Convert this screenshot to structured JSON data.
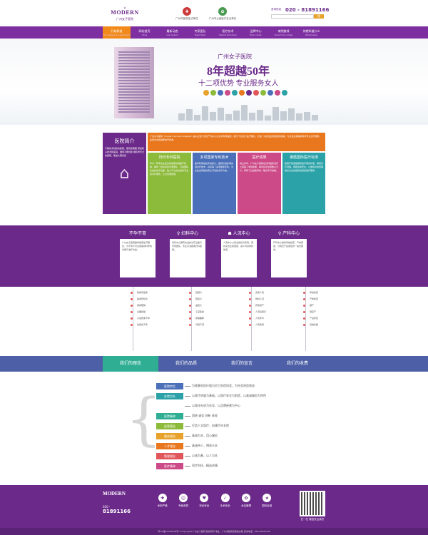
{
  "header": {
    "logo_mark": "MODERN",
    "logo_sub": "广州女子医院",
    "cert1_label": "广州市医保定点单位",
    "cert2_label": "广州市公费医疗定点单位",
    "hotline_label": "咨询热线",
    "hotline_number": "020 - 81891166",
    "search_placeholder": "",
    "search_button": "搜"
  },
  "nav": [
    {
      "cn": "开始释放",
      "en": "The meeting of a department",
      "active": true
    },
    {
      "cn": "网站首页",
      "en": "Home",
      "active": false
    },
    {
      "cn": "最新动态",
      "en": "new dynamic",
      "active": false
    },
    {
      "cn": "专家团队",
      "en": "Expert team",
      "active": false
    },
    {
      "cn": "医疗技术",
      "en": "Medical Technology",
      "active": false
    },
    {
      "cn": "品牌中心",
      "en": "Brand center",
      "active": false
    },
    {
      "cn": "来院路线",
      "en": "Route to the college",
      "active": false
    },
    {
      "cn": "你想知道什么",
      "en": "What besides",
      "active": false
    }
  ],
  "banner": {
    "title": "广州女子医院",
    "big": "8年超越50年",
    "sub": "十二项优势  专业服务女人",
    "icon_colors": [
      "#e8a22b",
      "#8cba3a",
      "#4b6fb8",
      "#cc4a87",
      "#2ba2a8",
      "#e9771e",
      "#6b2a8a",
      "#e0565a",
      "#8cba3a",
      "#4b6fb8",
      "#cc4a87",
      "#2ba2a8"
    ]
  },
  "intro": {
    "main_title": "医院简介",
    "main_text": "不断技术创新的医院，能到您需要 研发核心技术和医院，做到不断创新 拥有学术力的医院，能最大服务您",
    "orange_text": "广州女子医院（modern women hospital）是以女性门诊妇产为中心为主体专科医院，依托“专业化”医疗理念，打造广州女性生殖健康的权威，为女性患者提供科学专业诊疗服务，是南方女性健康的守护者。",
    "green_title": "妇科专科医院",
    "green_text": "作为一家专注女性生殖健康领域医疗机构，拥有一批资深的专家团队，引进国际先进的诊疗设备，致力于为女性提供专业的诊疗服务，让女性更健康。",
    "blue_title": "多项国家专利技术",
    "blue_text": "医学科研是技术的核心，医院引进多项先进诊疗技术，并获得了多项国家专利，为女性患者提供安全可靠的诊疗方案。",
    "pink_title": "医疗成果",
    "pink_text": "成立多年，广州女子医院在妇科临床治疗上取得了丰硕成果，每年接诊患者数以万计，获得了社会各界的一致好评与信赖。",
    "teal_title": "遵循国际医疗标准",
    "teal_text": "医院严格遵循国际医疗服务标准，规范诊疗流程，保障患者安全，以国际化的管理模式为女性提供优质的医疗服务。"
  },
  "centers": [
    {
      "title": "不孕不育",
      "text": "广州女子医院秉承健康生育理念，为不孕不育患者提供科学的诊断与治疗方案。"
    },
    {
      "title": "妇科中心",
      "text": "妇科中心拥有先进的诊疗设备与专家团队，专业诊治各类妇科疾病。"
    },
    {
      "title": "人流中心",
      "text": "人流中心以安全微创为原则，保护女性生殖健康，减少对身体的伤害。"
    },
    {
      "title": "产科中心",
      "text": "产科中心提供孕前检查、产前保健、分娩及产后康复的一站式服务。"
    }
  ],
  "timeline": [
    [
      "输卵管阻塞",
      "输卵管积水",
      "排卵障碍",
      "多囊卵巢",
      "子宫因素不孕",
      "免疫性不孕"
    ],
    [
      "宫颈炎",
      "阴道炎",
      "盆腔炎",
      "子宫肌瘤",
      "卵巢囊肿",
      "月经不调"
    ],
    [
      "无痛人流",
      "微创人流",
      "药物流产",
      "人流后保养",
      "人流手术",
      "人流费用"
    ],
    [
      "孕前检查",
      "产前检查",
      "顺产",
      "剖宫产",
      "产后修复",
      "四维彩超"
    ]
  ],
  "tabs": [
    "我们的理念",
    "我们的品质",
    "我们的宣言",
    "我们的收费"
  ],
  "values": [
    {
      "chip": "医院宗旨",
      "text": "为顾客创造价值为员工创造机会，为社会创造效益",
      "color": "#4b6fb8"
    },
    {
      "chip": "办院方针",
      "text": "以医疗质量为基础，以医疗安全为前提，以真诚服务为特色",
      "color": "#2ba2a8"
    },
    {
      "chip": "",
      "text": "以医技先进为先导，以品牌经营为中心",
      "color": "#ffffff"
    },
    {
      "chip": "医院精神",
      "text": "团结 诚信 创新 高效",
      "color": "#2fae93"
    },
    {
      "chip": "经营理念",
      "text": "打造人文医疗，创建百年名院",
      "color": "#8cba3a"
    },
    {
      "chip": "服务理念",
      "text": "真诚为本，用心服务",
      "color": "#e8a22b"
    },
    {
      "chip": "人才理念",
      "text": "真诚待人，博采众长",
      "color": "#e9771e"
    },
    {
      "chip": "管理理念",
      "text": "以诚为基，以人为本",
      "color": "#e0565a"
    },
    {
      "chip": "医疗精神",
      "text": "同步科技，精益求精",
      "color": "#cc4a87"
    }
  ],
  "footer": {
    "brand": "MODERN",
    "phone_label": "020 -",
    "phone": "81891166",
    "icons": [
      {
        "label": "术前严格",
        "glyph": "✚"
      },
      {
        "label": "专家资质",
        "glyph": "☺"
      },
      {
        "label": "安全安全",
        "glyph": "♥"
      },
      {
        "label": "手术安全",
        "glyph": "✓"
      },
      {
        "label": "术后管理",
        "glyph": "✿"
      },
      {
        "label": "国际标准",
        "glyph": "★"
      }
    ],
    "qr_label": "扫一扫 微信关注我们",
    "bottom": "粤ICP备12345678号-1  Copyright 广州女子医院 版权所有  地址：广州市越秀区解放北路  咨询电话：020-81891166"
  }
}
